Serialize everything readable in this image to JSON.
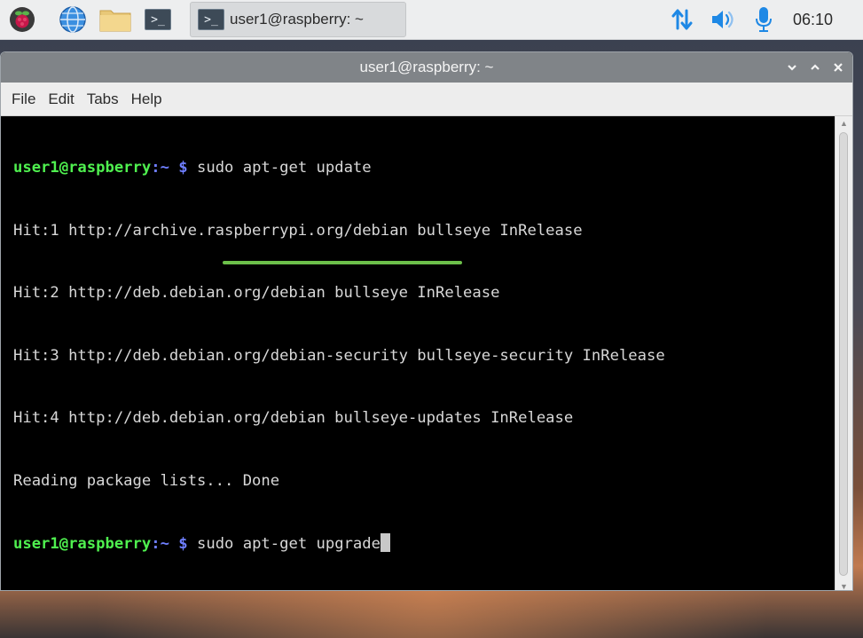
{
  "taskbar": {
    "launchers": [
      {
        "icon": "raspberry-menu-icon"
      },
      {
        "icon": "web-browser-globe-icon"
      },
      {
        "icon": "file-manager-folder-icon"
      },
      {
        "icon": "terminal-icon",
        "glyph": ">_"
      }
    ],
    "task": {
      "label": "user1@raspberry: ~",
      "glyph": ">_"
    },
    "tray": {
      "network_icon": "network-arrows-icon",
      "volume_icon": "volume-icon",
      "mic_icon": "microphone-icon"
    },
    "clock": "06:10",
    "colors": {
      "accent": "#1e88e5"
    }
  },
  "window": {
    "title": "user1@raspberry: ~",
    "controls": {
      "minimize": "⌄",
      "maximize": "⌃",
      "close": "✕"
    },
    "menu": [
      "File",
      "Edit",
      "Tabs",
      "Help"
    ]
  },
  "terminal": {
    "prompt_user": "user1@raspberry",
    "prompt_path": ":~",
    "prompt_symbol": "$",
    "lines": [
      {
        "type": "prompt",
        "command": "sudo apt-get update"
      },
      {
        "type": "output",
        "text": "Hit:1 http://archive.raspberrypi.org/debian bullseye InRelease"
      },
      {
        "type": "output",
        "text": "Hit:2 http://deb.debian.org/debian bullseye InRelease"
      },
      {
        "type": "output",
        "text": "Hit:3 http://deb.debian.org/debian-security bullseye-security InRelease"
      },
      {
        "type": "output",
        "text": "Hit:4 http://deb.debian.org/debian bullseye-updates InRelease"
      },
      {
        "type": "output",
        "text": "Reading package lists... Done"
      },
      {
        "type": "prompt",
        "command": "sudo apt-get upgrade",
        "active": true
      }
    ],
    "colors": {
      "user": "#4ff04f",
      "path": "#6f7fff",
      "text": "#d8d8d8",
      "highlight_underline": "#6cc04a"
    }
  }
}
